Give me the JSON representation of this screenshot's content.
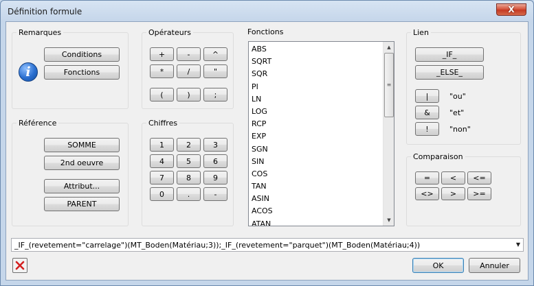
{
  "window": {
    "title": "Définition formule",
    "close_label": "X"
  },
  "remarques": {
    "label": "Remarques",
    "conditions": "Conditions",
    "fonctions": "Fonctions",
    "info_glyph": "i"
  },
  "operateurs": {
    "label": "Opérateurs",
    "row1": [
      "+",
      "-",
      "^"
    ],
    "row2": [
      "*",
      "/",
      "\""
    ],
    "row3": [
      "(",
      ")",
      ";"
    ]
  },
  "fonctions": {
    "label": "Fonctions",
    "items": [
      "ABS",
      "SQRT",
      "SQR",
      "PI",
      "LN",
      "LOG",
      "RCP",
      "EXP",
      "SGN",
      "SIN",
      "COS",
      "TAN",
      "ASIN",
      "ACOS",
      "ATAN"
    ]
  },
  "lien": {
    "label": "Lien",
    "if": "_IF_",
    "else": "_ELSE_",
    "or_symbol": "|",
    "or_label": "\"ou\"",
    "and_symbol": "&",
    "and_label": "\"et\"",
    "not_symbol": "!",
    "not_label": "\"non\""
  },
  "reference": {
    "label": "Référence",
    "somme": "SOMME",
    "second_oeuvre": "2nd oeuvre",
    "attribut": "Attribut...",
    "parent": "PARENT"
  },
  "chiffres": {
    "label": "Chiffres",
    "row1": [
      "1",
      "2",
      "3"
    ],
    "row2": [
      "4",
      "5",
      "6"
    ],
    "row3": [
      "7",
      "8",
      "9"
    ],
    "row4": [
      "0",
      ".",
      "-"
    ]
  },
  "comparaison": {
    "label": "Comparaison",
    "row1": [
      "=",
      "<",
      "<="
    ],
    "row2": [
      "<>",
      ">",
      ">="
    ]
  },
  "formula": {
    "value": "_IF_(revetement=\"carrelage\")(MT_Boden(Matériau;3));_IF_(revetement=\"parquet\")(MT_Boden(Matériau;4))"
  },
  "footer": {
    "ok": "OK",
    "cancel": "Annuler"
  },
  "colors": {
    "delete_icon": "#d42020",
    "title_close": "#c43a22"
  }
}
